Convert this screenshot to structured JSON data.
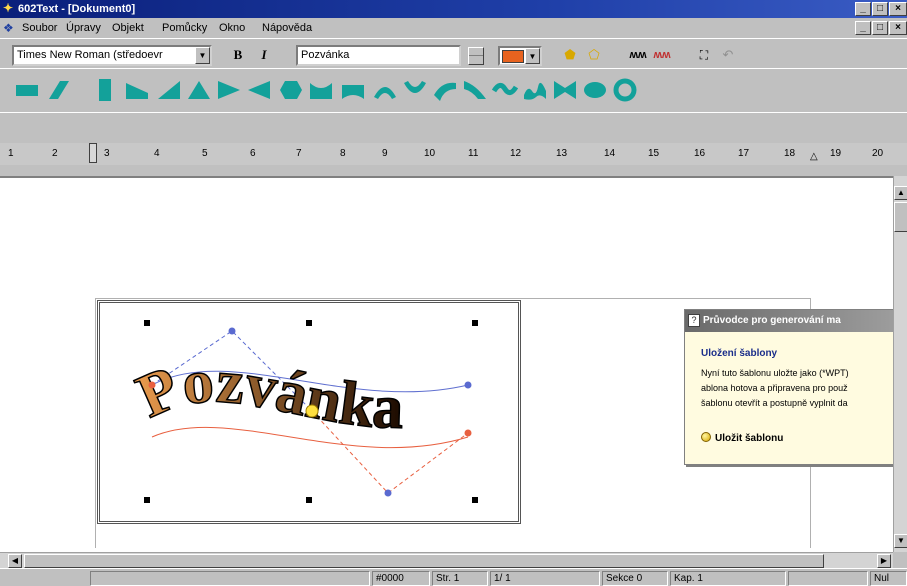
{
  "window": {
    "title": "602Text - [Dokument0]"
  },
  "menu": {
    "items": [
      {
        "label": "Soubor"
      },
      {
        "label": "Úpravy"
      },
      {
        "label": "Objekt"
      },
      {
        "label": "Pomůcky"
      },
      {
        "label": "Okno"
      },
      {
        "label": "Nápověda"
      }
    ]
  },
  "toolbar": {
    "font": "Times New Roman (středoevr",
    "bold_label": "B",
    "italic_label": "I",
    "text_value": "Pozvánka",
    "fill_color": "#e8631f",
    "shapes": [
      "rectangle",
      "parallelogram",
      "tall-rectangle",
      "trapezoid",
      "right-triangle",
      "triangle",
      "arrow-right",
      "arrow-left",
      "hexagon",
      "wave-down",
      "wave-cup",
      "arch-up",
      "arch-down",
      "slant",
      "curve",
      "wave",
      "double-wave",
      "bowtie",
      "ellipse",
      "ring"
    ]
  },
  "ruler": {
    "labels": [
      "1",
      "2",
      "3",
      "4",
      "5",
      "6",
      "7",
      "8",
      "9",
      "10",
      "11",
      "12",
      "13",
      "14",
      "15",
      "16",
      "17",
      "18",
      "19",
      "20"
    ]
  },
  "document": {
    "wordart_text": "Pozvánka",
    "gradient_start": "#f0a050",
    "gradient_end": "#1a0a00"
  },
  "wizard": {
    "title": "Průvodce pro generování ma",
    "heading": "Uložení šablony",
    "lines": [
      "Nyní tuto šablonu uložte jako (*WPT)",
      "ablona hotova a připravena pro použ",
      "šablonu otevřít a postupně vyplnit da"
    ],
    "action": "Uložit šablonu"
  },
  "status": {
    "color": "#0000",
    "page": "Str. 1",
    "pages": "1/ 1",
    "section": "Sekce 0",
    "chapter": "Kap. 1",
    "mode": "Nul"
  }
}
